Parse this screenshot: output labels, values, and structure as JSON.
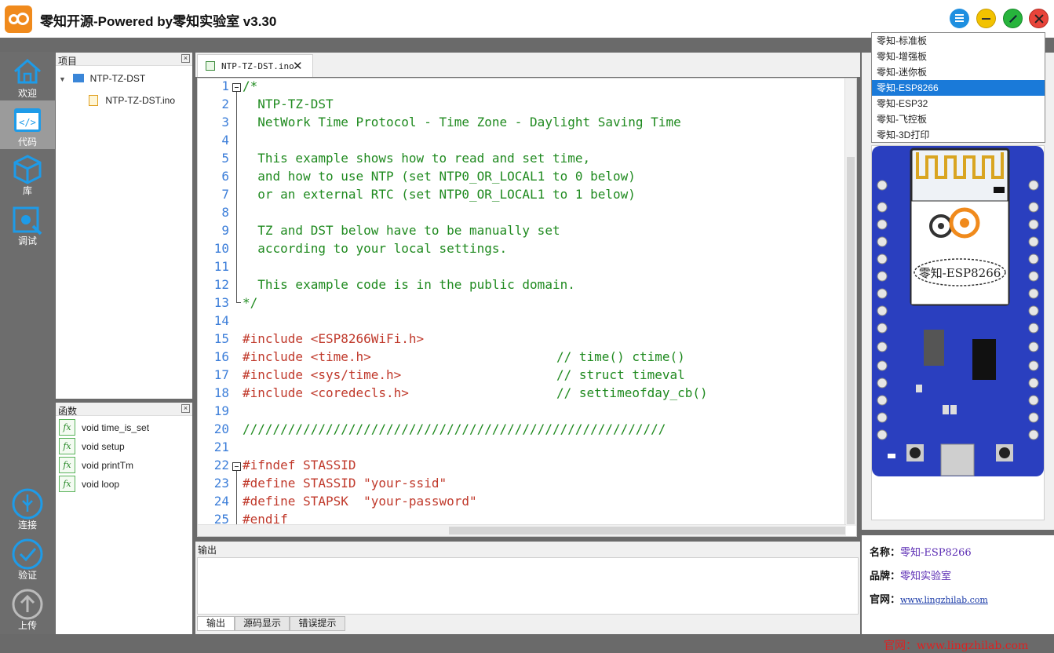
{
  "window": {
    "title": "零知开源-Powered by零知实验室 v3.30"
  },
  "nav": {
    "items": [
      {
        "label": "欢迎",
        "icon": "home-icon"
      },
      {
        "label": "代码",
        "icon": "code-icon"
      },
      {
        "label": "库",
        "icon": "cube-icon"
      },
      {
        "label": "调试",
        "icon": "debug-icon"
      }
    ],
    "bottom": [
      {
        "label": "连接",
        "icon": "usb-icon"
      },
      {
        "label": "验证",
        "icon": "check-icon"
      },
      {
        "label": "上传",
        "icon": "upload-icon"
      }
    ]
  },
  "project": {
    "title": "项目",
    "root": "NTP-TZ-DST",
    "file": "NTP-TZ-DST.ino"
  },
  "functions": {
    "title": "函数",
    "items": [
      "void time_is_set",
      "void setup",
      "void printTm",
      "void loop"
    ],
    "icon_text": "fx"
  },
  "editor": {
    "tab": "NTP-TZ-DST.ino",
    "lines": [
      {
        "n": "1",
        "text": "/*",
        "cls": "c-comment"
      },
      {
        "n": "2",
        "text": "  NTP-TZ-DST",
        "cls": "c-comment"
      },
      {
        "n": "3",
        "text": "  NetWork Time Protocol - Time Zone - Daylight Saving Time",
        "cls": "c-comment"
      },
      {
        "n": "4",
        "text": "",
        "cls": "c-comment"
      },
      {
        "n": "5",
        "text": "  This example shows how to read and set time,",
        "cls": "c-comment"
      },
      {
        "n": "6",
        "text": "  and how to use NTP (set NTP0_OR_LOCAL1 to 0 below)",
        "cls": "c-comment"
      },
      {
        "n": "7",
        "text": "  or an external RTC (set NTP0_OR_LOCAL1 to 1 below)",
        "cls": "c-comment"
      },
      {
        "n": "8",
        "text": "",
        "cls": "c-comment"
      },
      {
        "n": "9",
        "text": "  TZ and DST below have to be manually set",
        "cls": "c-comment"
      },
      {
        "n": "10",
        "text": "  according to your local settings.",
        "cls": "c-comment"
      },
      {
        "n": "11",
        "text": "",
        "cls": "c-comment"
      },
      {
        "n": "12",
        "text": "  This example code is in the public domain.",
        "cls": "c-comment"
      },
      {
        "n": "13",
        "text": "*/",
        "cls": "c-comment"
      },
      {
        "n": "14",
        "text": "",
        "cls": "c-comment"
      },
      {
        "n": "15",
        "text": "#include <ESP8266WiFi.h>",
        "cls": "c-pre"
      },
      {
        "n": "16",
        "text": "#include <time.h>",
        "cls": "c-pre",
        "comment": "// time() ctime()"
      },
      {
        "n": "17",
        "text": "#include <sys/time.h>",
        "cls": "c-pre",
        "comment": "// struct timeval"
      },
      {
        "n": "18",
        "text": "#include <coredecls.h>",
        "cls": "c-pre",
        "comment": "// settimeofday_cb()"
      },
      {
        "n": "19",
        "text": "",
        "cls": "c-comment"
      },
      {
        "n": "20",
        "text": "////////////////////////////////////////////////////////",
        "cls": "c-comment"
      },
      {
        "n": "21",
        "text": "",
        "cls": "c-comment"
      },
      {
        "n": "22",
        "text": "#ifndef STASSID",
        "cls": "c-pre"
      },
      {
        "n": "23",
        "text": "#define STASSID \"your-ssid\"",
        "cls": "c-pre"
      },
      {
        "n": "24",
        "text": "#define STAPSK  \"your-password\"",
        "cls": "c-pre"
      },
      {
        "n": "25",
        "text": "#endif",
        "cls": "c-pre"
      }
    ]
  },
  "output": {
    "title": "输出",
    "tabs": [
      "输出",
      "源码显示",
      "错误提示"
    ]
  },
  "boards": {
    "items": [
      "零知-标准板",
      "零知-增强板",
      "零知-迷你板",
      "零知-ESP8266",
      "零知-ESP32",
      "零知-飞控板",
      "零知-3D打印"
    ],
    "selected_index": 3,
    "chip_label": "零知-ESP8266"
  },
  "info": {
    "name_key": "名称：",
    "name_val": "零知-ESP8266",
    "brand_key": "品牌：",
    "brand_val": "零知实验室",
    "site_key": "官网：",
    "site_val": "www.lingzhilab.com"
  },
  "status": {
    "text": "官网：www.lingzhilab.com"
  },
  "colors": {
    "accent": "#1a7ad9",
    "board": "#2a3fbf",
    "logo": "#f08a1c"
  }
}
